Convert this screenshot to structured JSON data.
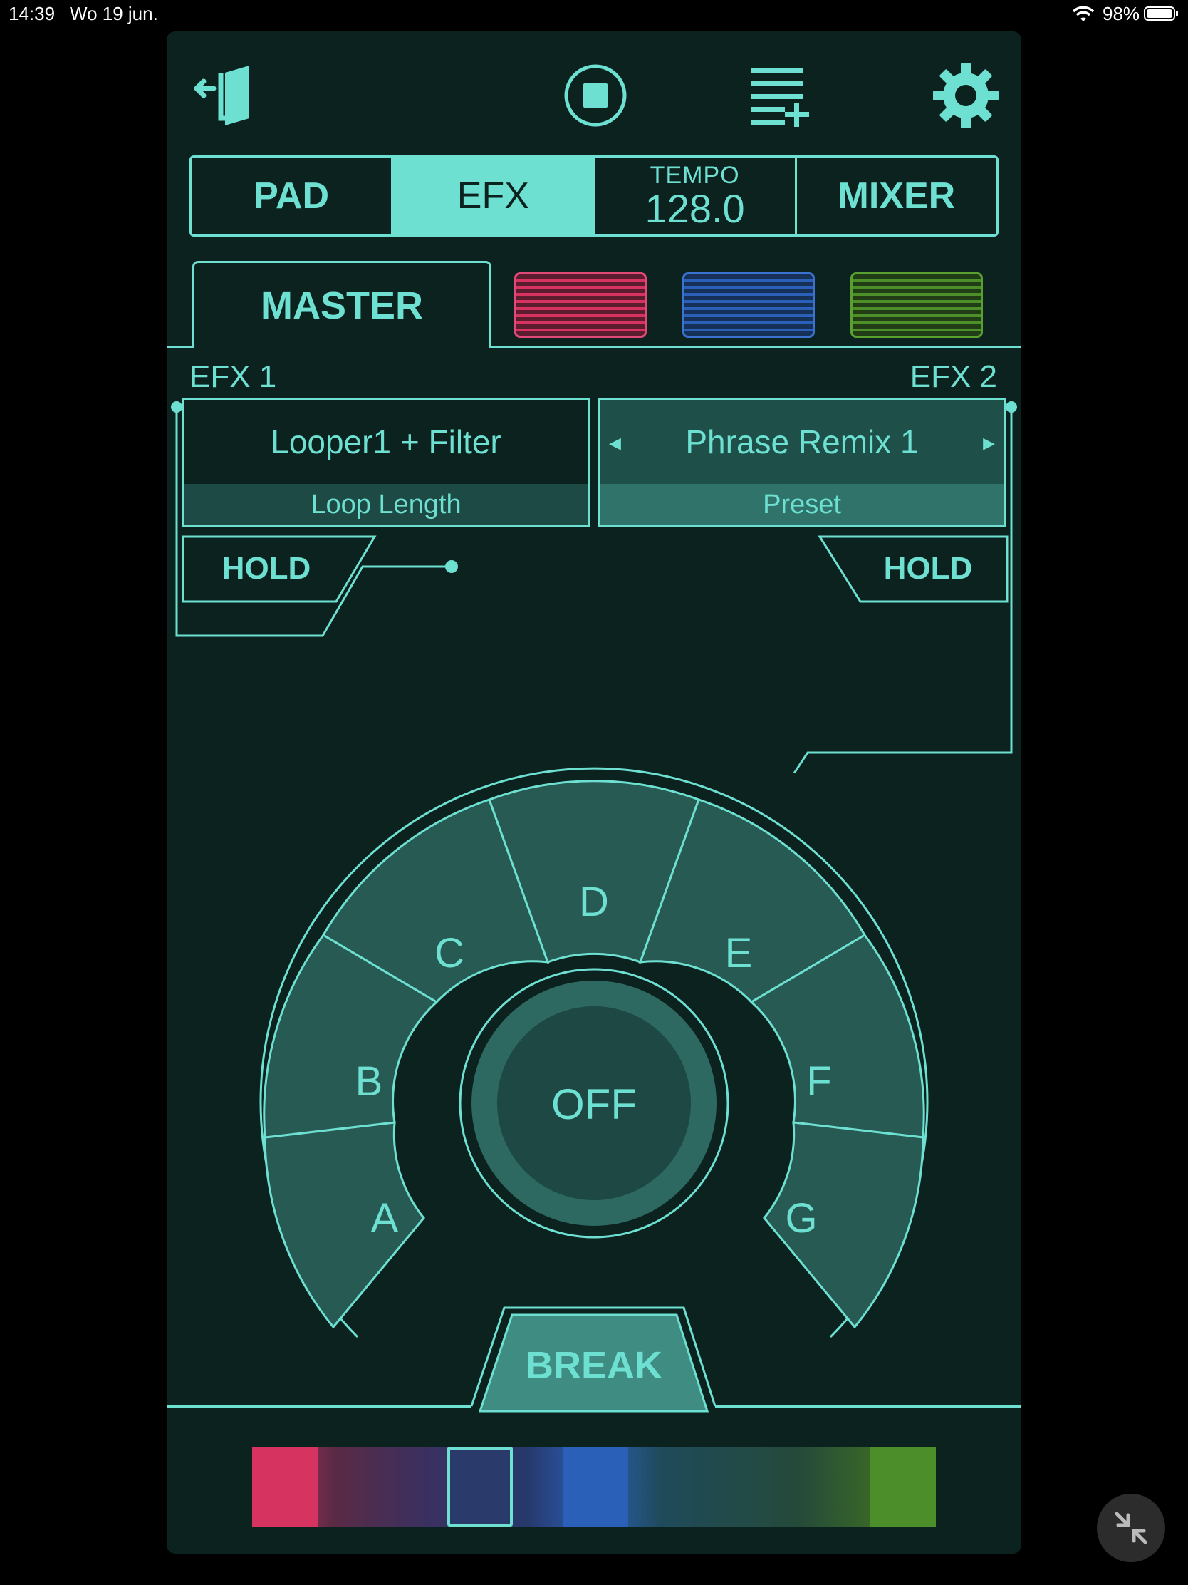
{
  "status_bar": {
    "time": "14:39",
    "date": "Wo 19 jun.",
    "battery": "98%"
  },
  "toolbar": {
    "exit_icon": "exit-door-icon",
    "stop_icon": "stop-icon",
    "list_add_icon": "playlist-add-icon",
    "settings_icon": "gear-icon"
  },
  "tabs": {
    "pad": "PAD",
    "efx": "EFX",
    "tempo_label": "TEMPO",
    "tempo_value": "128.0",
    "mixer": "MIXER"
  },
  "part_tabs": {
    "master": "MASTER"
  },
  "efx1": {
    "label": "EFX 1",
    "name": "Looper1 + Filter",
    "param": "Loop Length",
    "hold": "HOLD"
  },
  "efx2": {
    "label": "EFX 2",
    "name": "Phrase Remix 1",
    "param": "Preset",
    "hold": "HOLD"
  },
  "wheel": {
    "a": "A",
    "b": "B",
    "c": "C",
    "d": "D",
    "e": "E",
    "f": "F",
    "g": "G",
    "center": "OFF",
    "break": "BREAK"
  },
  "colors": {
    "accent": "#6de0d2",
    "background": "#0b221f",
    "pink": "#d63360",
    "blue": "#2b60b8",
    "green": "#4b8e2a"
  }
}
